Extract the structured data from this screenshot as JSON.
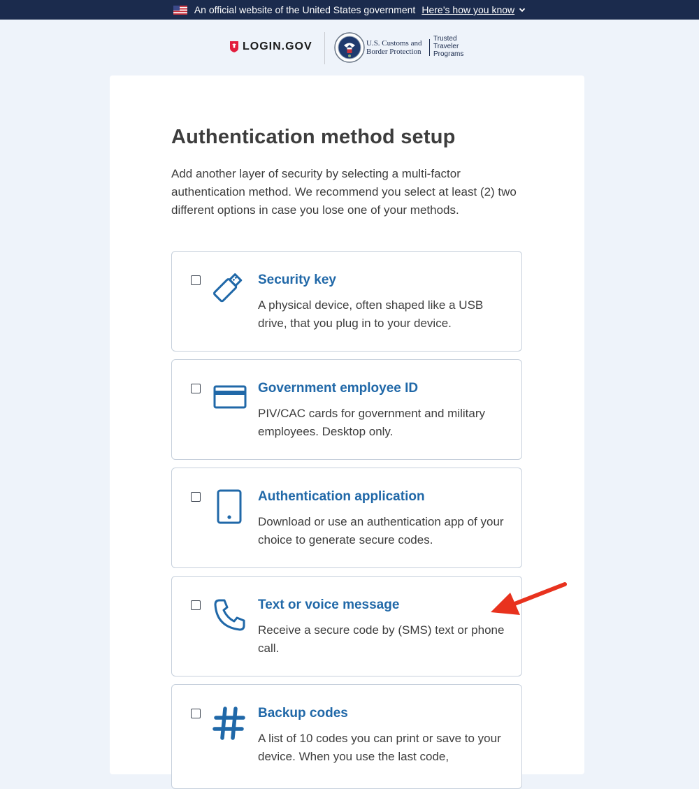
{
  "banner": {
    "text": "An official website of the United States government",
    "link": "Here’s how you know"
  },
  "header": {
    "brand": "LOGIN.GOV",
    "agency_line1": "U.S. Customs and",
    "agency_line2": "Border Protection",
    "program_line1": "Trusted",
    "program_line2": "Traveler",
    "program_line3": "Programs"
  },
  "page": {
    "title": "Authentication method setup",
    "intro": "Add another layer of security by selecting a multi-factor authentication method. We recommend you select at least (2) two different options in case you lose one of your methods."
  },
  "options": [
    {
      "title": "Security key",
      "description": "A physical device, often shaped like a USB drive, that you plug in to your device.",
      "icon": "usb-key-icon",
      "checked": false
    },
    {
      "title": "Government employee ID",
      "description": "PIV/CAC cards for government and military employees. Desktop only.",
      "icon": "id-card-icon",
      "checked": false
    },
    {
      "title": "Authentication application",
      "description": "Download or use an authentication app of your choice to generate secure codes.",
      "icon": "tablet-icon",
      "checked": false
    },
    {
      "title": "Text or voice message",
      "description": "Receive a secure code by (SMS) text or phone call.",
      "icon": "phone-icon",
      "checked": false
    },
    {
      "title": "Backup codes",
      "description": "A list of 10 codes you can print or save to your device. When you use the last code,",
      "icon": "hash-icon",
      "checked": false
    }
  ],
  "colors": {
    "banner_bg": "#1b2b4d",
    "page_bg": "#eef3fa",
    "link_blue": "#2068a8",
    "brand_red": "#e21c3d",
    "annotation_red": "#e8321e"
  }
}
